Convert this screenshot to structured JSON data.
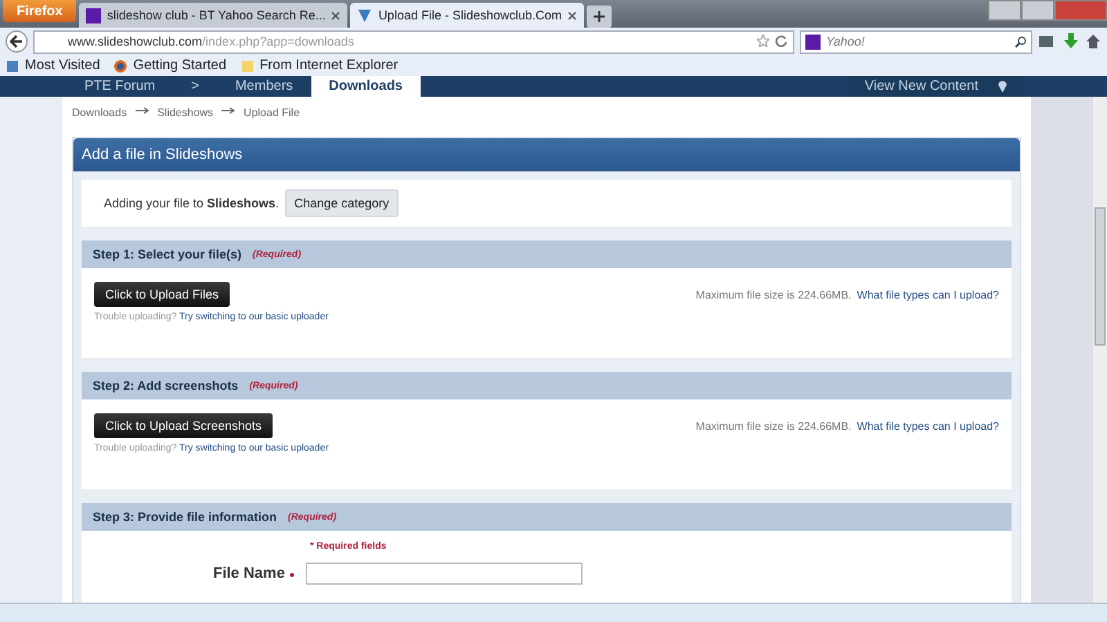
{
  "browser": {
    "menu_button": "Firefox",
    "tabs": [
      {
        "title": "slideshow club - BT Yahoo Search Re...",
        "selected": false,
        "kind": "yahoo"
      },
      {
        "title": "Upload File - Slideshowclub.Com",
        "selected": true,
        "kind": "site"
      }
    ],
    "address": {
      "host": "www.slideshowclub.com",
      "path": "/index.php?app=downloads"
    },
    "search": {
      "placeholder": "Yahoo!"
    },
    "bookmarks": [
      {
        "label": "Most Visited",
        "kind": "page"
      },
      {
        "label": "Getting Started",
        "kind": "firefox"
      },
      {
        "label": "From Internet Explorer",
        "kind": "folder"
      }
    ]
  },
  "site_nav": {
    "items": [
      {
        "label": "PTE Forum",
        "selected": false
      },
      {
        "label": ">",
        "selected": false
      },
      {
        "label": "Members",
        "selected": false
      },
      {
        "label": "Downloads",
        "selected": true
      }
    ],
    "right_link": "View New Content"
  },
  "breadcrumb": [
    "Downloads",
    "Slideshows",
    "Upload File"
  ],
  "card": {
    "title": "Add a file in Slideshows",
    "category": {
      "text": "Adding your file to **Slideshows**.",
      "button": "Change category"
    },
    "steps": [
      {
        "title": "Step 1: Select your file(s)",
        "required": "(Required)",
        "kind": "upload",
        "button": "Click to Upload Files",
        "trouble": "Trouble uploading?",
        "trouble_link": "Try switching to our basic uploader",
        "max_size": "Maximum file size is 224.66MB.",
        "types_link": "What file types can I upload?"
      },
      {
        "title": "Step 2: Add screenshots",
        "required": "(Required)",
        "kind": "upload",
        "button": "Click to Upload Screenshots",
        "trouble": "Trouble uploading?",
        "trouble_link": "Try switching to our basic uploader",
        "max_size": "Maximum file size is 224.66MB.",
        "types_link": "What file types can I upload?"
      },
      {
        "title": "Step 3: Provide file information",
        "required": "(Required)",
        "kind": "form",
        "note": "* Required fields",
        "fields": [
          {
            "label": "File Name",
            "required": true
          }
        ]
      }
    ]
  }
}
